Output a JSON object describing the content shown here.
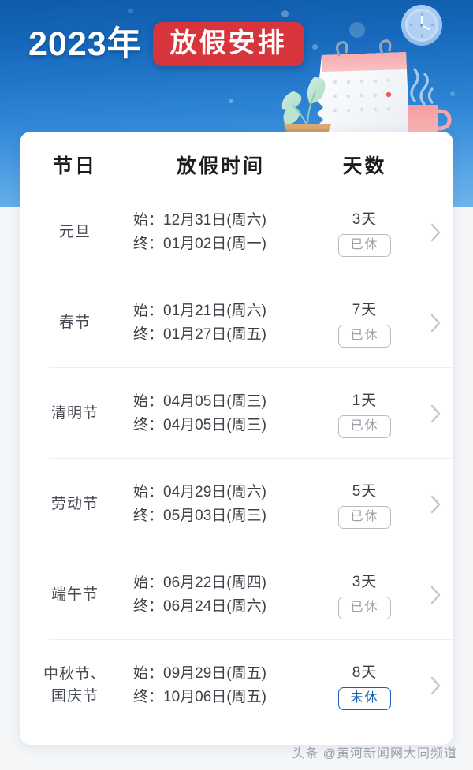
{
  "banner": {
    "year_label": "2023年",
    "headline": "放假安排",
    "accent_red": "#d8343c",
    "gradient_from": "#0f5ba9",
    "gradient_to": "#6fb3ec",
    "illustration_items": [
      "wall-clock",
      "desk-calendar",
      "potted-plant",
      "coffee-mug",
      "steam"
    ]
  },
  "table": {
    "headers": {
      "holiday": "节日",
      "period": "放假时间",
      "days": "天数"
    },
    "labels": {
      "start": "始：",
      "end": "终："
    },
    "rows": [
      {
        "name_line1": "元旦",
        "name_line2": "",
        "start": "12月31日(周六)",
        "end": "01月02日(周一)",
        "days": "3天",
        "status": "已休",
        "status_state": "done"
      },
      {
        "name_line1": "春节",
        "name_line2": "",
        "start": "01月21日(周六)",
        "end": "01月27日(周五)",
        "days": "7天",
        "status": "已休",
        "status_state": "done"
      },
      {
        "name_line1": "清明节",
        "name_line2": "",
        "start": "04月05日(周三)",
        "end": "04月05日(周三)",
        "days": "1天",
        "status": "已休",
        "status_state": "done"
      },
      {
        "name_line1": "劳动节",
        "name_line2": "",
        "start": "04月29日(周六)",
        "end": "05月03日(周三)",
        "days": "5天",
        "status": "已休",
        "status_state": "done"
      },
      {
        "name_line1": "端午节",
        "name_line2": "",
        "start": "06月22日(周四)",
        "end": "06月24日(周六)",
        "days": "3天",
        "status": "已休",
        "status_state": "done"
      },
      {
        "name_line1": "中秋节、",
        "name_line2": "国庆节",
        "start": "09月29日(周五)",
        "end": "10月06日(周五)",
        "days": "8天",
        "status": "未休",
        "status_state": "pending"
      }
    ]
  },
  "footer": {
    "watermark": "头条 @黄河新闻网大同频道"
  },
  "colors": {
    "badge_done_border": "#b9bec4",
    "badge_done_text": "#9aa0a7",
    "badge_pending": "#1a5fb4",
    "chevron": "#c2c6cb"
  }
}
